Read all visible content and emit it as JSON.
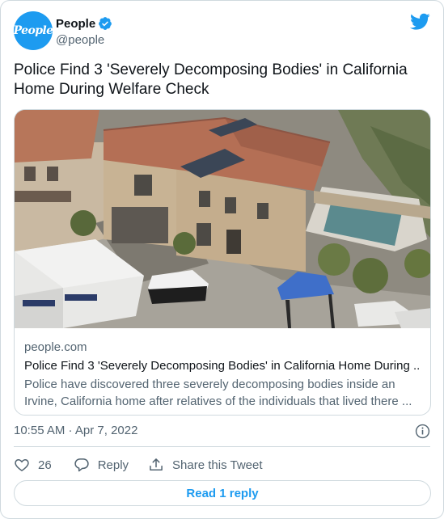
{
  "author": {
    "avatar_text": "People",
    "display_name": "People",
    "handle": "@people",
    "verified": true
  },
  "tweet": {
    "text": "Police Find 3 'Severely Decomposing Bodies' in California Home During Welfare Check",
    "timestamp": "10:55 AM · Apr 7, 2022"
  },
  "link_card": {
    "domain": "people.com",
    "title": "Police Find 3 'Severely Decomposing Bodies' in California Home During ...",
    "description": "Police have discovered three severely decomposing bodies inside an Irvine, California home after relatives of the individuals that lived there ..."
  },
  "actions": {
    "like_count": "26",
    "reply_label": "Reply",
    "share_label": "Share this Tweet"
  },
  "read_replies": "Read 1 reply",
  "icons": [
    "verified-badge-icon",
    "twitter-bird-icon",
    "info-icon",
    "heart-icon",
    "reply-bubble-icon",
    "share-icon"
  ],
  "colors": {
    "accent": "#1d9bf0",
    "secondary_text": "#536471",
    "border": "#cfd9de"
  }
}
